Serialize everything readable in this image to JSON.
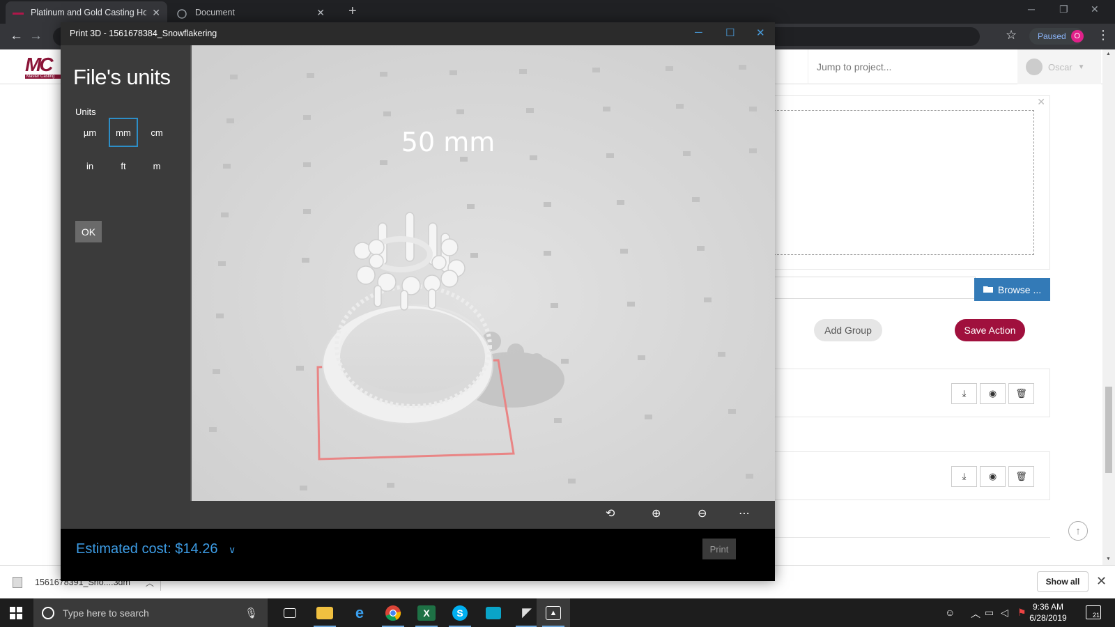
{
  "browser": {
    "tabs": [
      {
        "title": "Platinum and Gold Casting House",
        "active": true
      },
      {
        "title": "Document",
        "active": false
      }
    ],
    "new_tab_symbol": "+",
    "paused_label": "Paused",
    "paused_count": "O"
  },
  "site": {
    "logo_text": "MC",
    "logo_sub": "Master Casting",
    "jump_placeholder": "Jump to project...",
    "user_name": "Oscar",
    "browse_label": "Browse ...",
    "add_group_label": "Add Group",
    "save_action_label": "Save Action"
  },
  "print3d": {
    "window_title": "Print 3D - 1561678384_Snowflakering",
    "heading": "File's units",
    "units_label": "Units",
    "units": [
      "µm",
      "mm",
      "cm",
      "in",
      "ft",
      "m"
    ],
    "selected_unit": "mm",
    "ok_label": "OK",
    "scale_label": "50 mm",
    "estimated_cost": "Estimated cost: $14.26",
    "print_label": "Print",
    "toolbar_icons": [
      "rotate-view-icon",
      "zoom-in-icon",
      "zoom-out-icon",
      "more-icon"
    ]
  },
  "downloads": {
    "file_name": "1561678391_Sno....3dm",
    "show_all_label": "Show all"
  },
  "taskbar": {
    "search_placeholder": "Type here to search",
    "time": "9:36 AM",
    "date": "6/28/2019",
    "notification_count": "21",
    "apps": [
      "task-view-icon",
      "file-explorer-icon",
      "edge-icon",
      "chrome-icon",
      "excel-icon",
      "skype-icon",
      "photos-icon",
      "rhino-icon",
      "print3d-icon"
    ]
  },
  "colors": {
    "brand": "#8b1538",
    "save_action": "#a0103d",
    "browse": "#337ab7",
    "cost_text": "#3d9de6",
    "unit_selected_border": "#2d8ec7"
  }
}
